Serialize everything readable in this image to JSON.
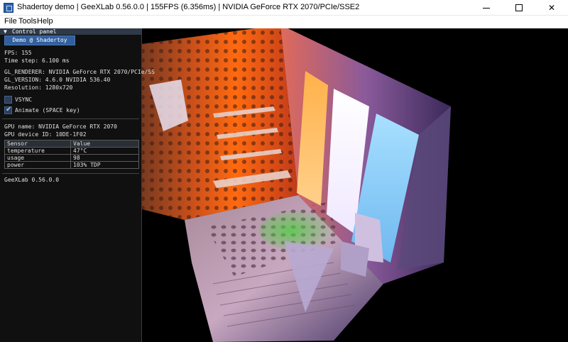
{
  "window": {
    "title": "Shadertoy demo | GeeXLab 0.56.0.0 | 155FPS (6.356ms) | NVIDIA GeForce RTX 2070/PCIe/SSE2",
    "minimize_glyph": "",
    "maximize_glyph": "",
    "close_glyph": "✕"
  },
  "menu": {
    "file": "File",
    "tools": "Tools",
    "help": "Help"
  },
  "panel": {
    "arrow": "▼",
    "title": "Control panel",
    "demo_button": "Demo @ Shadertoy",
    "fps": "FPS: 155",
    "time_step": "Time step: 6.100 ms",
    "gl_renderer": "GL_RENDERER: NVIDIA GeForce RTX 2070/PCIe/SS",
    "gl_version": "GL_VERSION: 4.6.0 NVIDIA 536.40",
    "resolution": "Resolution: 1280x720",
    "vsync_label": "VSYNC",
    "vsync_checked": false,
    "animate_label": "Animate (SPACE key)",
    "animate_checked": true,
    "checkmark": "✔",
    "gpu_name": "GPU name: NVIDIA GeForce RTX 2070",
    "gpu_device_id": "GPU device ID: 10DE-1F02",
    "sensor_headers": [
      "Sensor",
      "Value"
    ],
    "sensors": [
      [
        "temperature",
        "47°C"
      ],
      [
        "usage",
        "98"
      ],
      [
        "power",
        "103% TDP"
      ]
    ],
    "footer": "GeeXLab 0.56.0.0"
  },
  "colors": {
    "panel_header": "#2f3a48",
    "button": "#325f9e",
    "warm_light": "#ff7a1a",
    "cool_light": "#8fd2ff",
    "green_light": "#40c040"
  }
}
